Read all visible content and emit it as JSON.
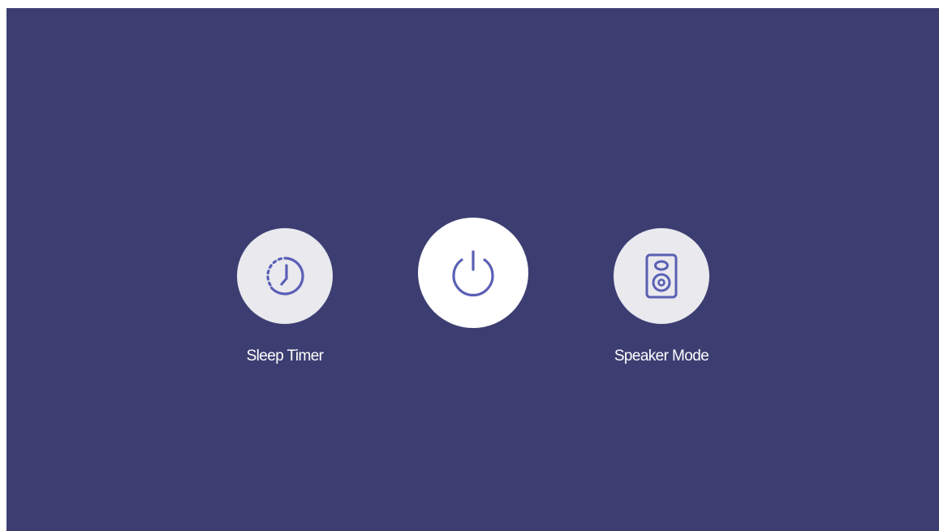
{
  "colors": {
    "background": "#3c3e72",
    "icon_stroke": "#5a5fb5",
    "small_button_fill": "#e9e9ee",
    "power_button_fill": "#ffffff",
    "label_text": "#ffffff"
  },
  "controls": {
    "sleep_timer": {
      "label": "Sleep Timer",
      "icon": "clock-icon"
    },
    "power": {
      "icon": "power-icon"
    },
    "speaker_mode": {
      "label": "Speaker Mode",
      "icon": "speaker-icon"
    }
  }
}
